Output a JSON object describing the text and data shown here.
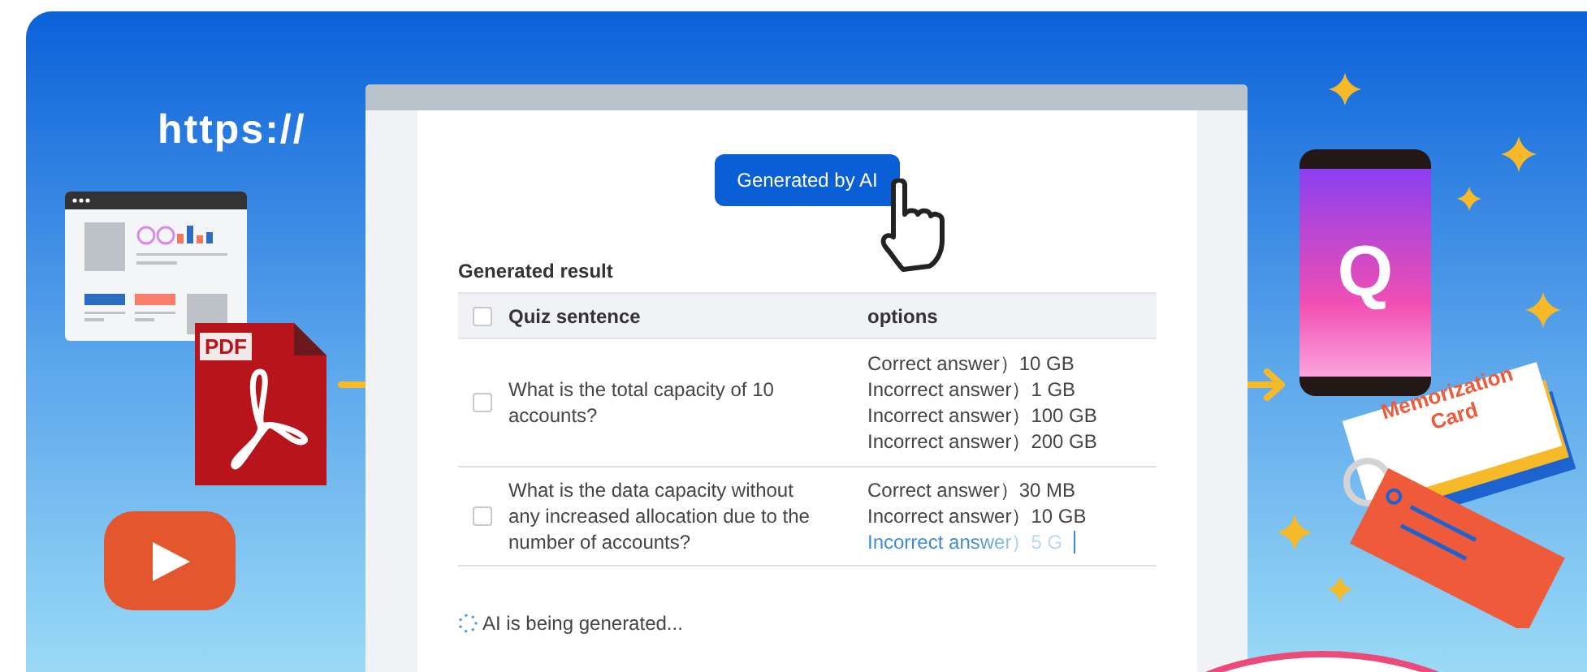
{
  "banner": {
    "url_label": "https://",
    "pdf_label": "PDF"
  },
  "window": {
    "generate_button": "Generated by AI",
    "section_title": "Generated result",
    "table": {
      "header_checked": false,
      "columns": [
        "Quiz sentence",
        "options"
      ],
      "rows": [
        {
          "checked": false,
          "question": "What is the total capacity of 10 accounts?",
          "options": [
            {
              "text": "Correct answer）10 GB",
              "kind": "done"
            },
            {
              "text": "Incorrect answer）1 GB",
              "kind": "done"
            },
            {
              "text": "Incorrect answer）100 GB",
              "kind": "done"
            },
            {
              "text": "Incorrect answer）200 GB",
              "kind": "done"
            }
          ]
        },
        {
          "checked": false,
          "question": "What is the data capacity without any increased allocation due to the number of accounts?",
          "options": [
            {
              "text": "Correct answer）30 MB",
              "kind": "done"
            },
            {
              "text": "Incorrect answer）10 GB",
              "kind": "done"
            },
            {
              "text": "Incorrect answer）5 G",
              "kind": "typing"
            }
          ]
        }
      ]
    },
    "status": "AI is being generated..."
  },
  "phone": {
    "letter": "Q"
  },
  "card": {
    "title": "Memorization Card"
  }
}
